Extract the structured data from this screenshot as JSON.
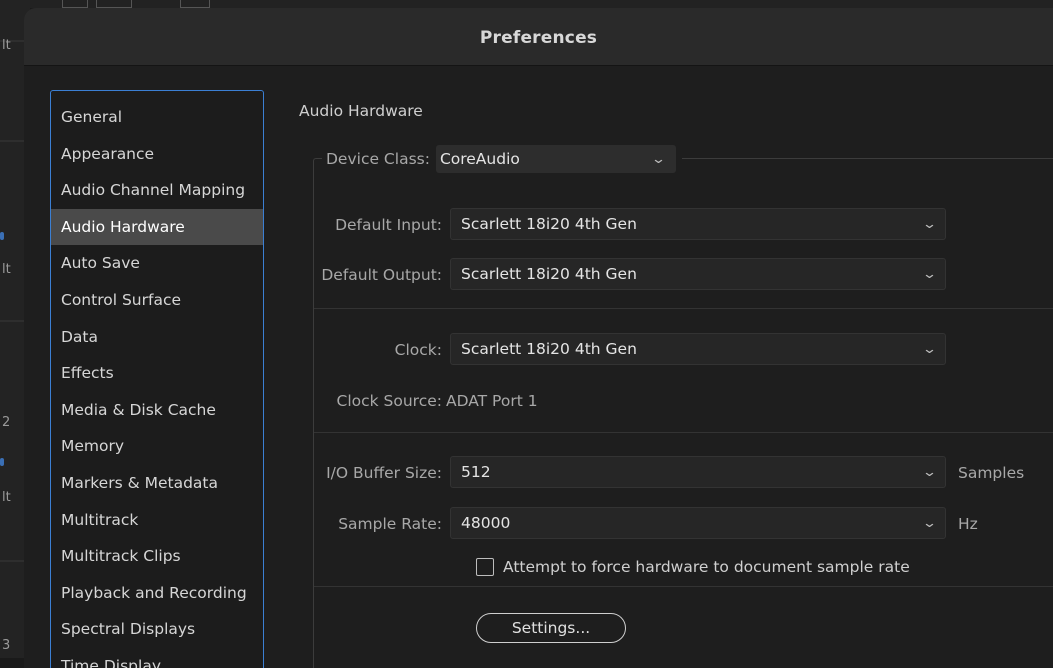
{
  "background_app": {
    "fragments": [
      "lt",
      "lt",
      "lt",
      "2",
      "3"
    ]
  },
  "dialog": {
    "title": "Preferences"
  },
  "sidebar": {
    "items": [
      {
        "label": "General",
        "selected": false
      },
      {
        "label": "Appearance",
        "selected": false
      },
      {
        "label": "Audio Channel Mapping",
        "selected": false
      },
      {
        "label": "Audio Hardware",
        "selected": true
      },
      {
        "label": "Auto Save",
        "selected": false
      },
      {
        "label": "Control Surface",
        "selected": false
      },
      {
        "label": "Data",
        "selected": false
      },
      {
        "label": "Effects",
        "selected": false
      },
      {
        "label": "Media & Disk Cache",
        "selected": false
      },
      {
        "label": "Memory",
        "selected": false
      },
      {
        "label": "Markers & Metadata",
        "selected": false
      },
      {
        "label": "Multitrack",
        "selected": false
      },
      {
        "label": "Multitrack Clips",
        "selected": false
      },
      {
        "label": "Playback and Recording",
        "selected": false
      },
      {
        "label": "Spectral Displays",
        "selected": false
      },
      {
        "label": "Time Display",
        "selected": false
      }
    ]
  },
  "panel": {
    "section_title": "Audio Hardware",
    "device_class": {
      "label": "Device Class:",
      "value": "CoreAudio"
    },
    "default_input": {
      "label": "Default Input:",
      "value": "Scarlett 18i20 4th Gen"
    },
    "default_output": {
      "label": "Default Output:",
      "value": "Scarlett 18i20 4th Gen"
    },
    "clock": {
      "label": "Clock:",
      "value": "Scarlett 18i20 4th Gen"
    },
    "clock_source": {
      "label": "Clock Source:",
      "value": "ADAT Port 1"
    },
    "buffer_size": {
      "label": "I/O Buffer Size:",
      "value": "512",
      "unit": "Samples"
    },
    "sample_rate": {
      "label": "Sample Rate:",
      "value": "48000",
      "unit": "Hz"
    },
    "force_rate": {
      "label": "Attempt to force hardware to document sample rate",
      "checked": false
    },
    "settings_button": "Settings...",
    "chevron": "⌄"
  },
  "colors": {
    "accent": "#3b7fd3",
    "selected_bg": "#4a4a4a",
    "dialog_bg": "#1e1e1e"
  }
}
